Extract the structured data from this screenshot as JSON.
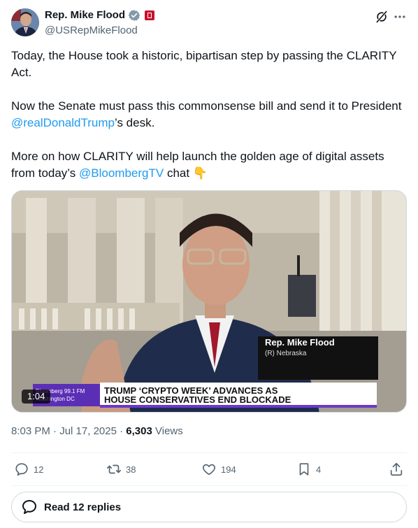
{
  "author": {
    "display_name": "Rep. Mike Flood",
    "handle": "@USRepMikeFlood"
  },
  "tweet": {
    "para1": "Today, the House took a historic, bipartisan step by passing the CLARITY Act.",
    "para2_before": "Now the Senate must pass this commonsense bill and send it to President ",
    "para2_mention": "@realDonaldTrump",
    "para2_after": "’s desk.",
    "para3_before": "More on how CLARITY will help launch the golden age of digital assets from today’s ",
    "para3_mention": "@BloombergTV",
    "para3_after": " chat ",
    "para3_emoji": "👇"
  },
  "video": {
    "duration": "1:04",
    "lower_third_name": "Rep. Mike Flood",
    "lower_third_sub": "(R) Nebraska",
    "bug_line1": "Bloomberg 99.1 FM",
    "bug_line2": "Washington DC",
    "headline_line1": "TRUMP ‘CRYPTO WEEK’ ADVANCES AS",
    "headline_line2": "HOUSE CONSERVATIVES END BLOCKADE"
  },
  "meta": {
    "time": "8:03 PM",
    "sep1": " · ",
    "date": "Jul 17, 2025",
    "sep2": " · ",
    "views_count": "6,303",
    "views_label": " Views"
  },
  "actions": {
    "replies": "12",
    "reposts": "38",
    "likes": "194",
    "bookmarks": "4"
  },
  "read_replies": "Read 12 replies",
  "colors": {
    "accent": "#1d9bf0",
    "text": "#0f1419",
    "muted": "#536471"
  },
  "icons": [
    "verified-badge-icon",
    "government-badge-icon",
    "grok-icon",
    "more-icon",
    "reply-icon",
    "repost-icon",
    "like-icon",
    "bookmark-icon",
    "share-icon",
    "chat-bubble-icon"
  ]
}
